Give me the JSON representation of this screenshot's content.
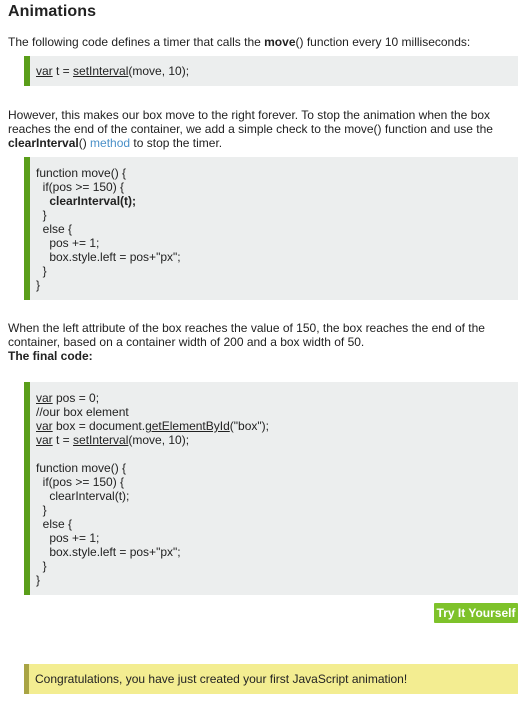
{
  "heading": "Animations",
  "intro": {
    "prefix": "The following code defines a timer that calls the ",
    "fn_name": "move",
    "suffix": "() function every 10 milliseconds:"
  },
  "code1": {
    "kw": "var",
    "text1": " t = ",
    "fn": "setInterval",
    "text2": "(move, 10);"
  },
  "para2": {
    "line1": "However, this makes our box move to the right forever. To stop the animation when the box",
    "line2": "reaches the end of the container, we add a simple check to the move() function and use the",
    "fn_name": "clearInterval",
    "paren": "() ",
    "link": "method",
    "tail": " to stop the timer."
  },
  "code2": {
    "l1": "function move() {",
    "l2": "  if(pos >= 150) {",
    "l3": "    clearInterval(t);",
    "l4": "  }",
    "l5": "  else {",
    "l6": "    pos += 1;",
    "l7": "    box.style.left = pos+\"px\";",
    "l8": "  }",
    "l9": "}"
  },
  "para3": {
    "line1": "When the left attribute of the box reaches the value of 150, the box reaches the end of the",
    "line2": "container, based on a container width of 200 and a box width of 50.",
    "line3": "The final code:"
  },
  "code3": {
    "var_kw": "var",
    "l1_rest": " pos = 0;",
    "l2": "//our box element",
    "l3_rest_a": " box = document.",
    "l3_fn": "getElementById",
    "l3_rest_b": "(\"box\");",
    "l4_rest_a": " t = ",
    "l4_fn": "setInterval",
    "l4_rest_b": "(move, 10);",
    "l6": "function move() {",
    "l7": "  if(pos >= 150) {",
    "l8": "    clearInterval(t);",
    "l9": "  }",
    "l10": "  else {",
    "l11": "    pos += 1;",
    "l12": "    box.style.left = pos+\"px\";",
    "l13": "  }",
    "l14": "}"
  },
  "try_button": "Try It Yourself",
  "congrats": "Congratulations, you have just created your first JavaScript animation!",
  "colors": {
    "code_border": "#5a9e1a",
    "code_bg": "#eceeee",
    "button_bg": "#7ec22a",
    "note_bg": "#f3ed91",
    "note_border": "#a9a444",
    "link": "#4a90c8"
  }
}
